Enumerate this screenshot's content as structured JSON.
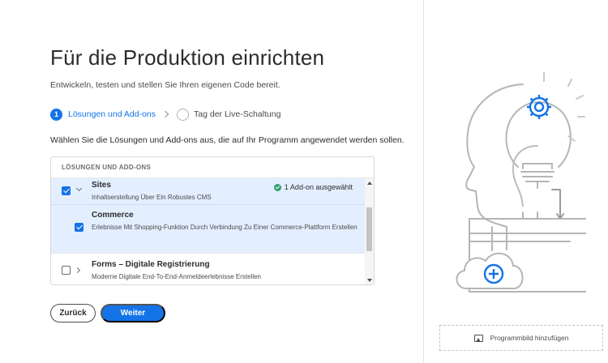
{
  "page": {
    "title": "Für die Produktion einrichten",
    "subtitle": "Entwickeln, testen und stellen Sie Ihren eigenen Code bereit.",
    "instruction": "Wählen Sie die Lösungen und Add-ons aus, die auf Ihr Programm angewendet werden sollen."
  },
  "steps": [
    {
      "number": "1",
      "label": "Lösungen und Add-ons",
      "active": true
    },
    {
      "number": "",
      "label": "Tag der Live-Schaltung",
      "active": false
    }
  ],
  "panel": {
    "header": "LÖSUNGEN UND ADD-ONS",
    "rows": [
      {
        "title": "Sites",
        "description": "Inhaltserstellung Über Ein Robustes CMS",
        "checked": true,
        "expanded": true,
        "status": "1 Add-on ausgewählt"
      },
      {
        "title": "Commerce",
        "description": "Erlebnisse Mit Shopping-Funktion Durch Verbindung Zu Einer Commerce-Plattform Erstellen",
        "checked": true
      },
      {
        "title": "Forms – Digitale Registrierung",
        "description": "Moderne Digitale End-To-End-Anmeldeerlebnisse Erstellen",
        "checked": false,
        "expanded": false
      }
    ]
  },
  "buttons": {
    "back": "Zurück",
    "next": "Weiter"
  },
  "sidebar": {
    "add_image": "Programmbild hinzufügen"
  },
  "colors": {
    "accent": "#1473e6",
    "selected_row": "#e3efff",
    "success": "#2d9d78"
  },
  "icons": [
    "gear-icon",
    "lightbulb-icon",
    "cloud-add-icon",
    "image-icon",
    "check-circle-icon",
    "chevron-down-icon",
    "chevron-right-icon"
  ]
}
